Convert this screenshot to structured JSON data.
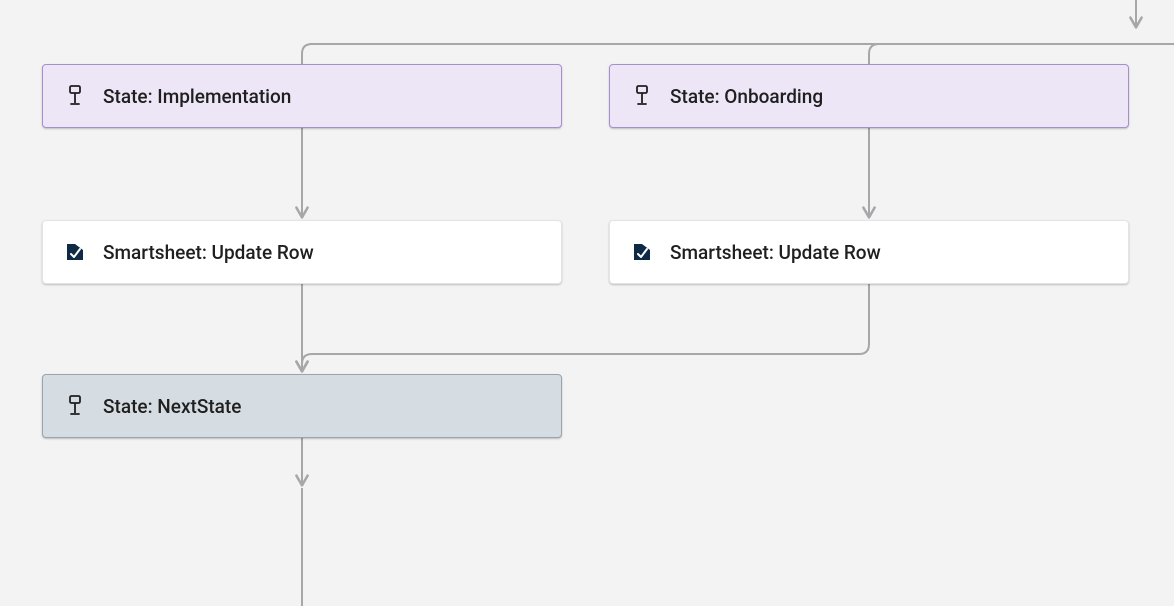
{
  "nodes": {
    "state_implementation": {
      "label": "State: Implementation"
    },
    "state_onboarding": {
      "label": "State: Onboarding"
    },
    "action_left": {
      "label": "Smartsheet: Update Row"
    },
    "action_right": {
      "label": "Smartsheet: Update Row"
    },
    "state_next": {
      "label": "State: NextState"
    }
  },
  "colors": {
    "connector": "#a7a7aa",
    "state_fill": "#ede6f6",
    "state_border": "#a58fd0",
    "action_fill": "#ffffff",
    "selected_fill": "#d6dde2",
    "smartsheet_logo": "#0f2a44"
  }
}
